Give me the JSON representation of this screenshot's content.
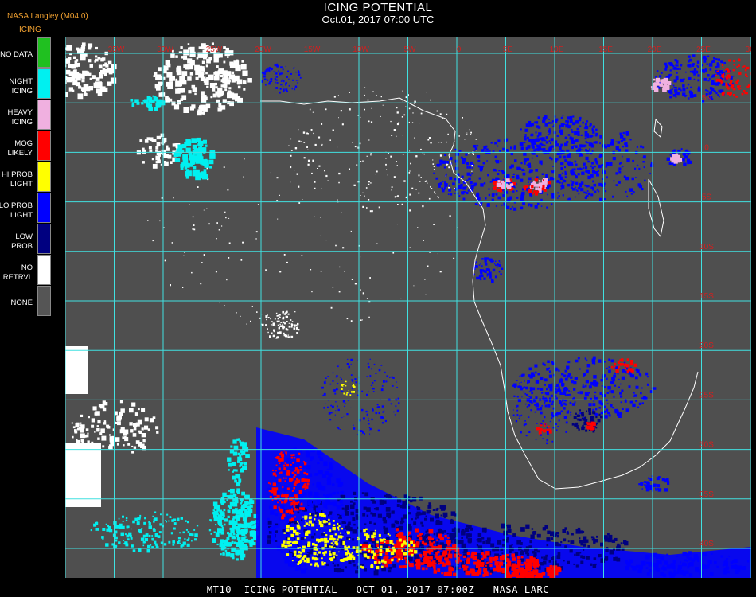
{
  "header": {
    "title": "ICING POTENTIAL",
    "subtitle": "Oct.01, 2017 07:00 UTC",
    "provider": "NASA Langley (M04.0)",
    "product": "ICING"
  },
  "legend": [
    {
      "label": "NO DATA",
      "color": "#20c020"
    },
    {
      "label": "NIGHT\nICING",
      "color": "#00f0f0"
    },
    {
      "label": "HEAVY\nICING",
      "color": "#f0b0e0"
    },
    {
      "label": "MOG\nLIKELY",
      "color": "#ff0000"
    },
    {
      "label": "HI PROB\nLIGHT",
      "color": "#ffff00"
    },
    {
      "label": "LO PROB\nLIGHT",
      "color": "#0000ff"
    },
    {
      "label": "LOW\nPROB",
      "color": "#000080"
    },
    {
      "label": "NO\nRETRVL",
      "color": "#ffffff"
    },
    {
      "label": "NONE",
      "color": "#555555"
    }
  ],
  "map": {
    "background": "#4f4f4f",
    "grid_color": "#40e0e0",
    "coast_color": "#ffffff",
    "label_color": "#d02020",
    "lon_labels": [
      "35W",
      "30W",
      "25W",
      "20W",
      "15W",
      "10W",
      "5W",
      "0",
      "5E",
      "10E",
      "15E",
      "20E",
      "25E",
      "30E",
      "35E"
    ],
    "lat_labels": [
      "5N",
      "0",
      "5S",
      "10S",
      "15S",
      "20S",
      "25S",
      "30S",
      "35S",
      "40S"
    ]
  },
  "footer": "MT10  ICING POTENTIAL   OCT 01, 2017 07:00Z   NASA LARC"
}
